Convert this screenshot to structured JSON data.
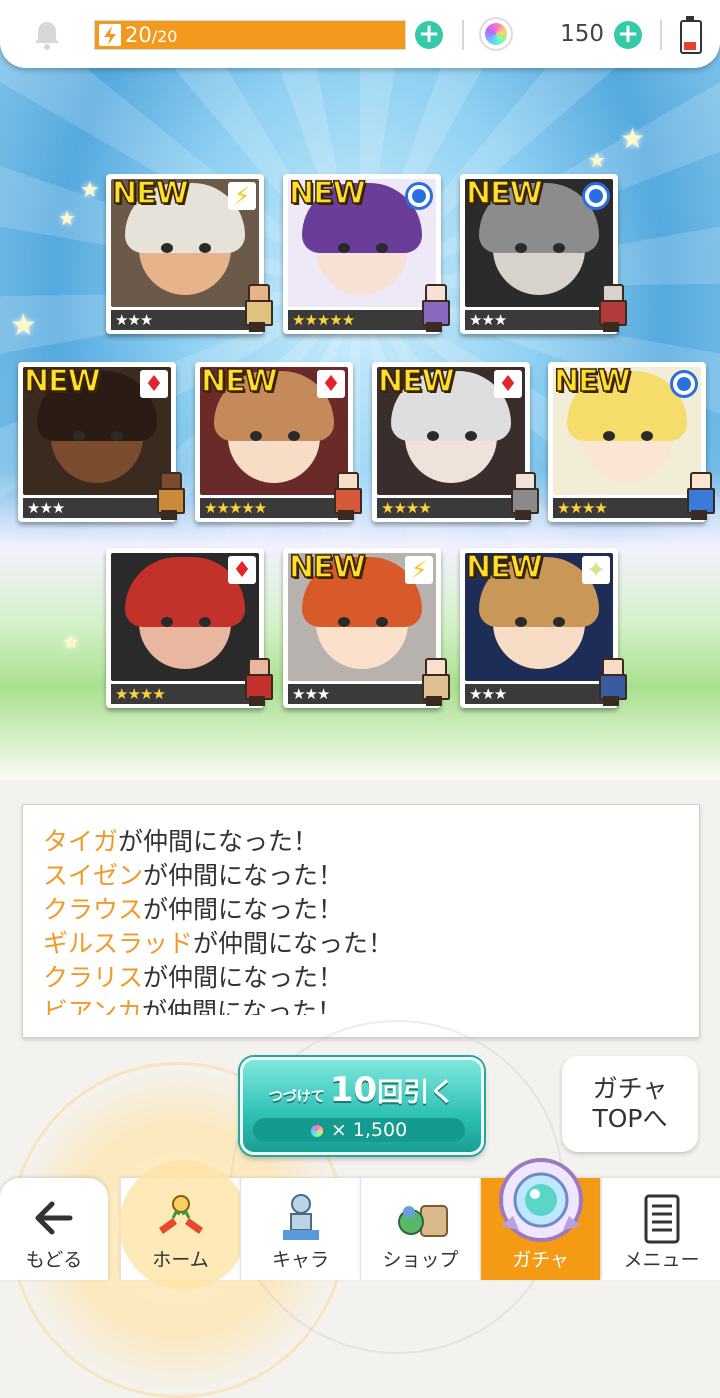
{
  "status_bar": {
    "stamina_current": "20",
    "stamina_max": "/20",
    "stamina_fraction": 1.0,
    "gem_count": "150"
  },
  "result": {
    "cards": [
      {
        "new_label": "NEW",
        "attribute": "yellow-bolt",
        "stars": "★★★",
        "rarity": 3
      },
      {
        "new_label": "NEW",
        "attribute": "blue-circle",
        "stars": "★★★★★",
        "rarity": 5
      },
      {
        "new_label": "NEW",
        "attribute": "blue-circle",
        "stars": "★★★",
        "rarity": 3
      },
      {
        "new_label": "NEW",
        "attribute": "red-diamond",
        "stars": "★★★",
        "rarity": 3
      },
      {
        "new_label": "NEW",
        "attribute": "red-diamond",
        "stars": "★★★★★",
        "rarity": 5
      },
      {
        "new_label": "NEW",
        "attribute": "red-diamond",
        "stars": "★★★★",
        "rarity": 4
      },
      {
        "new_label": "NEW",
        "attribute": "blue-circle",
        "stars": "★★★★",
        "rarity": 4
      },
      {
        "new_label": "",
        "attribute": "red-diamond",
        "stars": "★★★★",
        "rarity": 4
      },
      {
        "new_label": "NEW",
        "attribute": "yellow-bolt",
        "stars": "★★★",
        "rarity": 3
      },
      {
        "new_label": "NEW",
        "attribute": "light-sparkle",
        "stars": "★★★",
        "rarity": 3
      }
    ]
  },
  "messages": [
    {
      "name": "タイガ",
      "text": "が仲間になった！"
    },
    {
      "name": "スイゼン",
      "text": "が仲間になった！"
    },
    {
      "name": "クラウス",
      "text": "が仲間になった！"
    },
    {
      "name": "ギルスラッド",
      "text": "が仲間になった！"
    },
    {
      "name": "クラリス",
      "text": "が仲間になった！"
    },
    {
      "name": "ビアンカ",
      "text": "が仲間になった！"
    }
  ],
  "draw_button": {
    "prefix": "つづけて",
    "count": "10",
    "suffix": "回引く",
    "cost": "× 1,500"
  },
  "gacha_top_button": {
    "line1": "ガチャ",
    "line2": "TOPへ"
  },
  "nav": {
    "back": "もどる",
    "home": "ホーム",
    "chara": "キャラ",
    "shop": "ショップ",
    "gacha": "ガチャ",
    "menu": "メニュー"
  },
  "colors": {
    "accent_orange": "#f49a14",
    "teal_button": "#2ec0b4",
    "name_highlight": "#f09a2a"
  },
  "icons": {
    "bell": "bell-icon",
    "stamina": "bolt-icon",
    "gem": "rainbow-gem-icon",
    "battery": "battery-low-icon",
    "plus": "plus-icon"
  }
}
